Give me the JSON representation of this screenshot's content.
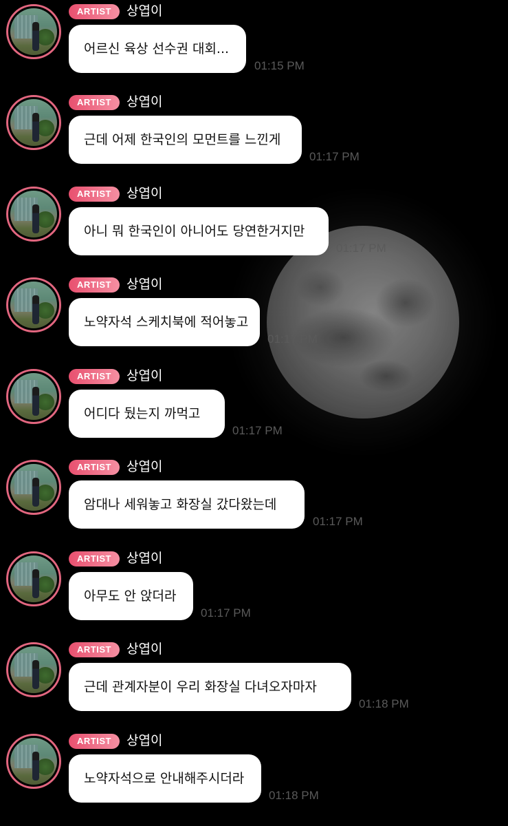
{
  "messages": [
    {
      "badge": "ARTIST",
      "sender": "상엽이",
      "text": "어르신 육상 선수권 대회...",
      "time": "01:15 PM"
    },
    {
      "badge": "ARTIST",
      "sender": "상엽이",
      "text": "근데 어제 한국인의 모먼트를 느낀게",
      "time": "01:17 PM"
    },
    {
      "badge": "ARTIST",
      "sender": "상엽이",
      "text": "아니 뭐 한국인이 아니어도 당연한거지만",
      "time": "01:17 PM"
    },
    {
      "badge": "ARTIST",
      "sender": "상엽이",
      "text": "노약자석 스케치북에 적어놓고",
      "time": "01:17 PM"
    },
    {
      "badge": "ARTIST",
      "sender": "상엽이",
      "text": "어디다 뒀는지 까먹고",
      "time": "01:17 PM"
    },
    {
      "badge": "ARTIST",
      "sender": "상엽이",
      "text": "암대나 세워놓고 화장실 갔다왔는데",
      "time": "01:17 PM"
    },
    {
      "badge": "ARTIST",
      "sender": "상엽이",
      "text": "아무도 안 앉더라",
      "time": "01:17 PM"
    },
    {
      "badge": "ARTIST",
      "sender": "상엽이",
      "text": "근데 관계자분이 우리 화장실 다녀오자마자",
      "time": "01:18 PM"
    },
    {
      "badge": "ARTIST",
      "sender": "상엽이",
      "text": "노약자석으로 안내해주시더라",
      "time": "01:18 PM"
    }
  ],
  "colors": {
    "background": "#000000",
    "bubble": "#ffffff",
    "badge_start": "#e8506f",
    "badge_end": "#f58fa2",
    "avatar_ring": "#e2667f",
    "timestamp": "#5a5a5a"
  },
  "icons": {
    "avatar": "profile-photo",
    "background_image": "full-moon-photo"
  }
}
